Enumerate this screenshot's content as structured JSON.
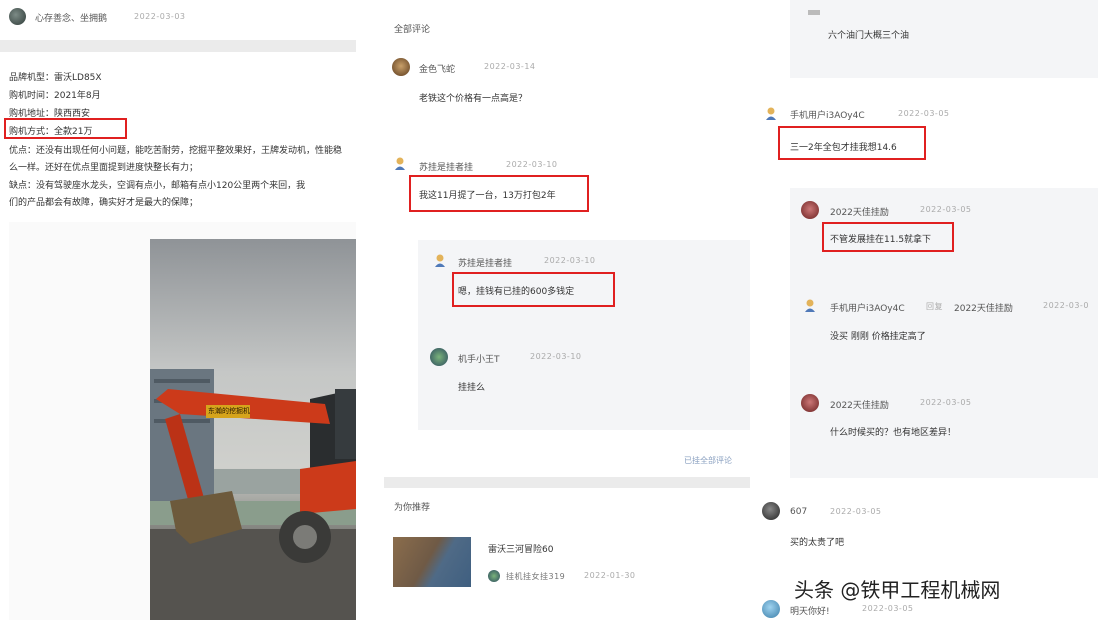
{
  "left": {
    "poster": "心存善念、坐拥鹅",
    "post_time": "2022-03-03",
    "info_lines": [
      "品牌机型：雷沃LD85X",
      "购机时间：2021年8月",
      "购机地址：陕西西安",
      "购机方式：全款21万"
    ],
    "pros": "优点：还没有出现任何小问题，能吃苦耐劳，挖掘平整效果好，王牌发动机，性能稳",
    "pros2": "么一样。还好在优点里面提到进度快整长有力；",
    "cons": "缺点：没有驾驶座水龙头，空调有点小，邮箱有点小120公里两个来回，我",
    "cons2": "们的产品都会有故障，确实好才是最大的保障；",
    "machine_label": "东瀚的挖掘机"
  },
  "middle": {
    "section_title": "全部评论",
    "comments": [
      {
        "user": "金色飞蛇",
        "time": "2022-03-14",
        "text": "老铁这个价格有一点高是？"
      },
      {
        "user": "苏挂是挂者挂",
        "time": "2022-03-10",
        "text": "我这11月提了一台，13万打包2年"
      }
    ],
    "replies": [
      {
        "user": "苏挂是挂者挂",
        "time": "2022-03-10",
        "text": "嗯，挂钱有已挂的600多钱定"
      },
      {
        "user": "机手小王T",
        "time": "2022-03-10",
        "text": "挂挂么"
      }
    ],
    "more_link": "已挂全部评论",
    "recommend_title": "为你推荐",
    "recommend_item": {
      "title": "雷沃三河冒险60",
      "author": "挂机挂女挂319",
      "time": "2022-01-30"
    }
  },
  "right": {
    "top_text": "六个油门大概三个油",
    "comment": {
      "user": "手机用户i3AOy4C",
      "time": "2022-03-05",
      "text": "三一2年全包才挂我想14.6"
    },
    "replies": [
      {
        "user": "2022天佳挂励",
        "time": "2022-03-05",
        "text": "不管发展挂在11.5就拿下"
      },
      {
        "user": "手机用户i3AOy4C",
        "via": "回复",
        "to": "2022天佳挂励",
        "time": "2022-03-0",
        "text": "没买 刚刚 价格挂定高了"
      },
      {
        "user": "2022天佳挂励",
        "time": "2022-03-05",
        "text": "什么时候买的？也有地区差异！"
      }
    ],
    "comment2": {
      "user": "607",
      "time": "2022-03-05",
      "text": "买的太贵了吧"
    },
    "comment3": {
      "user": "明天你好!",
      "time": "2022-03-05"
    }
  },
  "watermark": "头条 @铁甲工程机械网"
}
